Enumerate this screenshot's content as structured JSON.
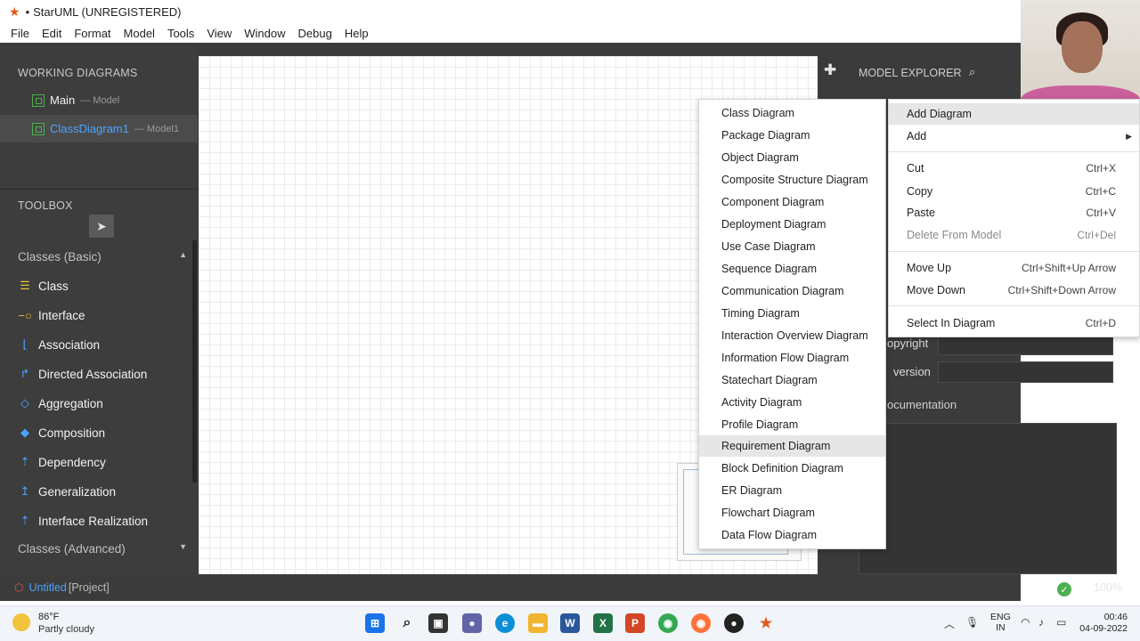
{
  "window": {
    "title": "StarUML (UNREGISTERED)",
    "title_prefix": "•"
  },
  "menubar": [
    "File",
    "Edit",
    "Format",
    "Model",
    "Tools",
    "View",
    "Window",
    "Debug",
    "Help"
  ],
  "working_diagrams": {
    "title": "WORKING DIAGRAMS",
    "items": [
      {
        "name": "Main",
        "sub": "— Model"
      },
      {
        "name": "ClassDiagram1",
        "sub": "— Model1"
      }
    ]
  },
  "toolbox": {
    "title": "TOOLBOX",
    "group_basic": "Classes (Basic)",
    "group_advanced": "Classes (Advanced)",
    "tools": [
      "Class",
      "Interface",
      "Association",
      "Directed Association",
      "Aggregation",
      "Composition",
      "Dependency",
      "Generalization",
      "Interface Realization"
    ]
  },
  "status": {
    "project_name": "Untitled",
    "project_tag": "[Project]",
    "zoom": "100%"
  },
  "model_explorer": {
    "title": "MODEL EXPLORER"
  },
  "properties": {
    "copyright_label": "opyright",
    "version_label": "version",
    "documentation_label": "ocumentation"
  },
  "add_diagram_submenu": [
    "Class Diagram",
    "Package Diagram",
    "Object Diagram",
    "Composite Structure Diagram",
    "Component Diagram",
    "Deployment Diagram",
    "Use Case Diagram",
    "Sequence Diagram",
    "Communication Diagram",
    "Timing Diagram",
    "Interaction Overview Diagram",
    "Information Flow Diagram",
    "Statechart Diagram",
    "Activity Diagram",
    "Profile Diagram",
    "Requirement Diagram",
    "Block Definition Diagram",
    "ER Diagram",
    "Flowchart Diagram",
    "Data Flow Diagram"
  ],
  "context_menu": {
    "add_diagram": "Add Diagram",
    "add": "Add",
    "cut": {
      "label": "Cut",
      "shortcut": "Ctrl+X"
    },
    "copy": {
      "label": "Copy",
      "shortcut": "Ctrl+C"
    },
    "paste": {
      "label": "Paste",
      "shortcut": "Ctrl+V"
    },
    "delete": {
      "label": "Delete From Model",
      "shortcut": "Ctrl+Del"
    },
    "move_up": {
      "label": "Move Up",
      "shortcut": "Ctrl+Shift+Up Arrow"
    },
    "move_down": {
      "label": "Move Down",
      "shortcut": "Ctrl+Shift+Down Arrow"
    },
    "select_in_diagram": {
      "label": "Select In Diagram",
      "shortcut": "Ctrl+D"
    }
  },
  "taskbar": {
    "weather_temp": "86°F",
    "weather_desc": "Partly cloudy",
    "lang_line1": "ENG",
    "lang_line2": "IN",
    "time": "00:46",
    "date": "04-09-2022"
  },
  "colors": {
    "accent_blue": "#4da3ff",
    "diagram_green": "#4caf50",
    "tool_yellow": "#e8c13a",
    "panel_bg": "#3b3b3b"
  },
  "icons": [
    "puzzle-icon",
    "search-icon",
    "cursor-icon",
    "check-icon"
  ]
}
